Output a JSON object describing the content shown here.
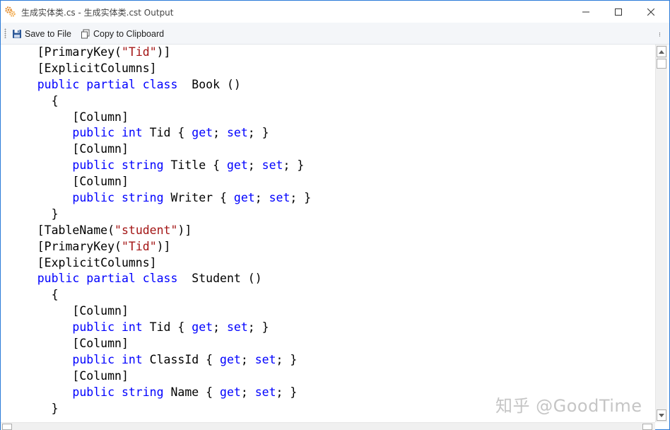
{
  "window": {
    "title": "生成实体类.cs - 生成实体类.cst Output",
    "controls": {
      "minimize": "minimize-icon",
      "maximize": "maximize-icon",
      "close": "close-icon"
    }
  },
  "toolbar": {
    "save_label": "Save to File",
    "copy_label": "Copy to Clipboard",
    "overflow_glyph": "⁝"
  },
  "code_lines": [
    [
      {
        "t": "    [PrimaryKey(",
        "c": ""
      },
      {
        "t": "\"Tid\"",
        "c": "str"
      },
      {
        "t": ")]",
        "c": ""
      }
    ],
    [
      {
        "t": "    [ExplicitColumns]",
        "c": ""
      }
    ],
    [
      {
        "t": "    ",
        "c": ""
      },
      {
        "t": "public partial class",
        "c": "kw"
      },
      {
        "t": "  Book ()",
        "c": ""
      }
    ],
    [
      {
        "t": "      {",
        "c": ""
      }
    ],
    [
      {
        "t": "         [Column]",
        "c": ""
      }
    ],
    [
      {
        "t": "         ",
        "c": ""
      },
      {
        "t": "public int",
        "c": "kw"
      },
      {
        "t": " Tid { ",
        "c": ""
      },
      {
        "t": "get",
        "c": "kw"
      },
      {
        "t": "; ",
        "c": ""
      },
      {
        "t": "set",
        "c": "kw"
      },
      {
        "t": "; }",
        "c": ""
      }
    ],
    [
      {
        "t": "         [Column]",
        "c": ""
      }
    ],
    [
      {
        "t": "         ",
        "c": ""
      },
      {
        "t": "public string",
        "c": "kw"
      },
      {
        "t": " Title { ",
        "c": ""
      },
      {
        "t": "get",
        "c": "kw"
      },
      {
        "t": "; ",
        "c": ""
      },
      {
        "t": "set",
        "c": "kw"
      },
      {
        "t": "; }",
        "c": ""
      }
    ],
    [
      {
        "t": "         [Column]",
        "c": ""
      }
    ],
    [
      {
        "t": "         ",
        "c": ""
      },
      {
        "t": "public string",
        "c": "kw"
      },
      {
        "t": " Writer { ",
        "c": ""
      },
      {
        "t": "get",
        "c": "kw"
      },
      {
        "t": "; ",
        "c": ""
      },
      {
        "t": "set",
        "c": "kw"
      },
      {
        "t": "; }",
        "c": ""
      }
    ],
    [
      {
        "t": "      }",
        "c": ""
      }
    ],
    [
      {
        "t": "    [TableName(",
        "c": ""
      },
      {
        "t": "\"student\"",
        "c": "str"
      },
      {
        "t": ")]",
        "c": ""
      }
    ],
    [
      {
        "t": "    [PrimaryKey(",
        "c": ""
      },
      {
        "t": "\"Tid\"",
        "c": "str"
      },
      {
        "t": ")]",
        "c": ""
      }
    ],
    [
      {
        "t": "    [ExplicitColumns]",
        "c": ""
      }
    ],
    [
      {
        "t": "    ",
        "c": ""
      },
      {
        "t": "public partial class",
        "c": "kw"
      },
      {
        "t": "  Student ()",
        "c": ""
      }
    ],
    [
      {
        "t": "      {",
        "c": ""
      }
    ],
    [
      {
        "t": "         [Column]",
        "c": ""
      }
    ],
    [
      {
        "t": "         ",
        "c": ""
      },
      {
        "t": "public int",
        "c": "kw"
      },
      {
        "t": " Tid { ",
        "c": ""
      },
      {
        "t": "get",
        "c": "kw"
      },
      {
        "t": "; ",
        "c": ""
      },
      {
        "t": "set",
        "c": "kw"
      },
      {
        "t": "; }",
        "c": ""
      }
    ],
    [
      {
        "t": "         [Column]",
        "c": ""
      }
    ],
    [
      {
        "t": "         ",
        "c": ""
      },
      {
        "t": "public int",
        "c": "kw"
      },
      {
        "t": " ClassId { ",
        "c": ""
      },
      {
        "t": "get",
        "c": "kw"
      },
      {
        "t": "; ",
        "c": ""
      },
      {
        "t": "set",
        "c": "kw"
      },
      {
        "t": "; }",
        "c": ""
      }
    ],
    [
      {
        "t": "         [Column]",
        "c": ""
      }
    ],
    [
      {
        "t": "         ",
        "c": ""
      },
      {
        "t": "public string",
        "c": "kw"
      },
      {
        "t": " Name { ",
        "c": ""
      },
      {
        "t": "get",
        "c": "kw"
      },
      {
        "t": "; ",
        "c": ""
      },
      {
        "t": "set",
        "c": "kw"
      },
      {
        "t": "; }",
        "c": ""
      }
    ],
    [
      {
        "t": "      }",
        "c": ""
      }
    ]
  ],
  "colors": {
    "keyword": "#0000ff",
    "string": "#a31515",
    "text": "#000000",
    "window_border": "#2b7bd8",
    "toolbar_bg": "#f4f6f9"
  },
  "watermark": "知乎 @GoodTime"
}
